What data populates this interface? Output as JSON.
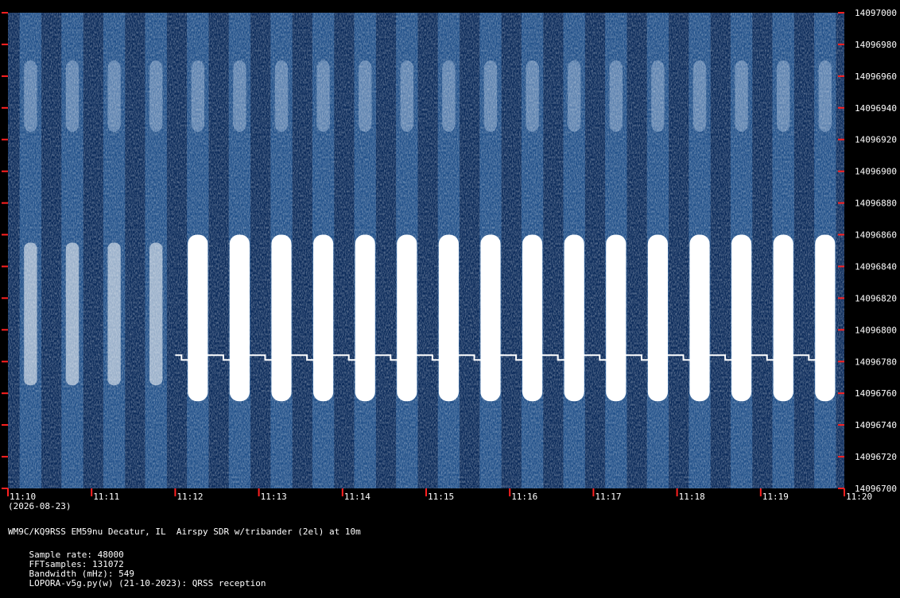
{
  "window": {
    "title": "WM9C/KQ9RSS EM59nu Decatur, IL  Airspy SDR w/tribander (2el) at 10m"
  },
  "colors": {
    "background": "#000000",
    "waterfall_low": "#0a2a5a",
    "waterfall_high": "#ffffff",
    "tick": "#ff2020",
    "carrier": "#ffffff"
  },
  "chart_data": {
    "type": "heatmap",
    "title": "WM9C/KQ9RSS EM59nu Decatur, IL  Airspy SDR w/tribander (2el) at 10m",
    "x_ticks": [
      "11:10",
      "11:11",
      "11:12",
      "11:13",
      "11:14",
      "11:15",
      "11:16",
      "11:17",
      "11:18",
      "11:19",
      "11:20"
    ],
    "x_start_minutes": 670,
    "x_end_minutes": 680,
    "date": "(2026-08-23)",
    "y_ticks": [
      "14097000",
      "14096980",
      "14096960",
      "14096940",
      "14096920",
      "14096900",
      "14096880",
      "14096860",
      "14096840",
      "14096820",
      "14096800",
      "14096780",
      "14096760",
      "14096740",
      "14096720",
      "14096700"
    ],
    "ylim": [
      14096700,
      14097000
    ],
    "carrier_hz": 14096780,
    "carrier_start_minutes": 672.0,
    "carrier_end_minutes": 679.8,
    "strong_band_hz": [
      14096765,
      14096860
    ],
    "grid": false
  },
  "footer": {
    "sample_rate": "Sample rate: 48000",
    "fft_samples": "FFTsamples: 131072",
    "bandwidth": "Bandwidth (mHz): 549",
    "software": "LOPORA-v5g.py(w) (21-10-2023): QRSS reception"
  }
}
